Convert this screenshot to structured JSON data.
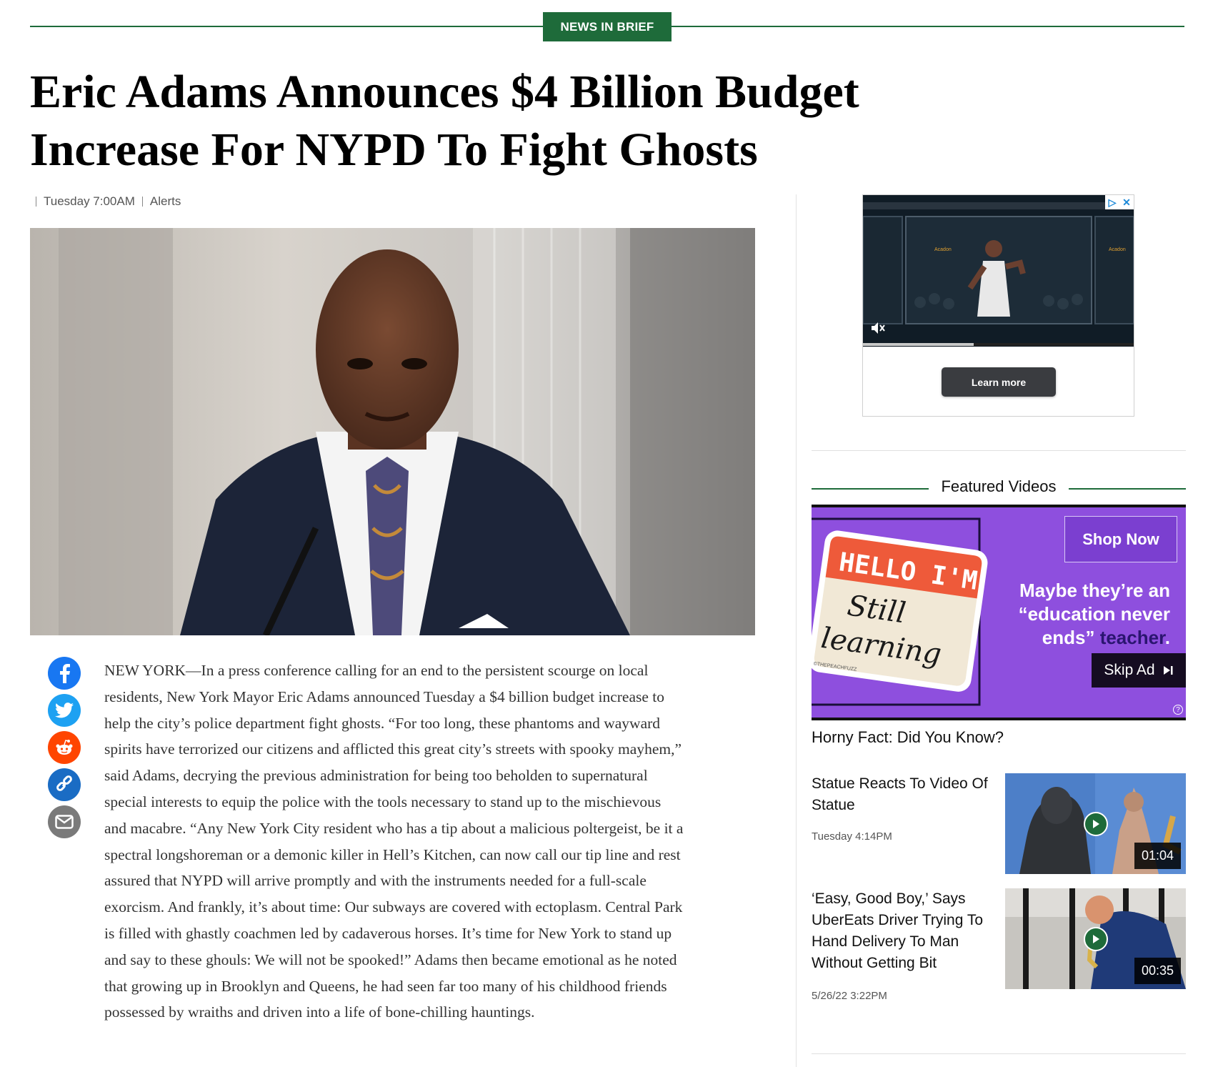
{
  "section": {
    "tag": "NEWS IN BRIEF"
  },
  "article": {
    "headline": "Eric Adams Announces $4 Billion Budget Increase For NYPD To Fight Ghosts",
    "date": "Tuesday 7:00AM",
    "category": "Alerts",
    "body": "NEW YORK—In a press conference calling for an end to the persistent scourge on local residents, New York Mayor Eric Adams announced Tuesday a $4 billion budget increase to help the city’s police department fight ghosts. “For too long, these phantoms and wayward spirits have terrorized our citizens and afflicted this great city’s streets with spooky mayhem,” said Adams, decrying the previous administration for being too beholden to supernatural special interests to equip the police with the tools necessary to stand up to the mischievous and macabre. “Any New York City resident who has a tip about a malicious poltergeist, be it a spectral longshoreman or a demonic killer in Hell’s Kitchen, can now call our tip line and rest assured that NYPD will arrive promptly and with the instruments needed for a full-scale exorcism. And frankly, it’s about time: Our subways are covered with ectoplasm. Central Park is filled with ghastly coachmen led by cadaverous horses. It’s time for New York to stand up and say to these ghouls: We will not be spooked!” Adams then became emotional as he noted that growing up in Brooklyn and Queens, he had seen far too many of his childhood friends possessed by wraiths and driven into a life of bone-chilling hauntings."
  },
  "share_icons": [
    "facebook-icon",
    "twitter-icon",
    "reddit-icon",
    "link-icon",
    "email-icon"
  ],
  "ad": {
    "learn_more": "Learn more",
    "brand_text": "Acadon",
    "progress": 0.41
  },
  "featured": {
    "title": "Featured Videos",
    "ad": {
      "shop_now": "Shop Now",
      "sticker_hello": "HELLO I'M",
      "sticker_script_1": "Still",
      "sticker_script_2": "learning",
      "sticker_credit": "©THEPEACHFUZZ",
      "copy_line1": "Maybe they’re an",
      "copy_line2": "“education never",
      "copy_line3a": "ends” ",
      "copy_line3b": "teacher",
      "copy_line3c": ".",
      "skip": "Skip Ad",
      "help": "?"
    },
    "caption": "Horny Fact: Did You Know?",
    "videos": [
      {
        "title": "Statue Reacts To Video Of Statue",
        "date": "Tuesday 4:14PM",
        "duration": "01:04"
      },
      {
        "title": "‘Easy, Good Boy,’ Says UberEats Driver Trying To Hand Delivery To Man Without Getting Bit",
        "date": "5/26/22 3:22PM",
        "duration": "00:35"
      }
    ]
  },
  "colors": {
    "brand_green": "#1e6b3a",
    "ad_purple": "#8e4fde"
  }
}
